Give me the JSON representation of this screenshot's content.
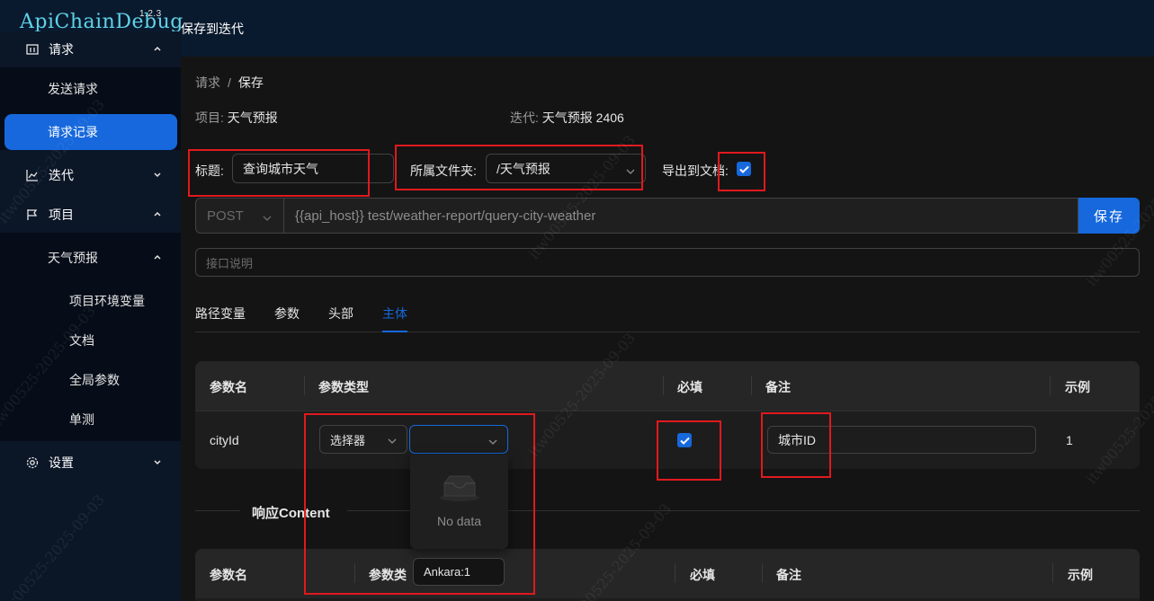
{
  "app": {
    "logo": "ApiChainDebug",
    "version": "1.2.3",
    "header_title": "保存到迭代"
  },
  "sidebar": {
    "request_group": "请求",
    "send_request": "发送请求",
    "request_history": "请求记录",
    "iteration_group": "迭代",
    "project_group": "项目",
    "weather_project": "天气预报",
    "env_vars": "项目环境变量",
    "docs": "文档",
    "global_params": "全局参数",
    "unit_test": "单测",
    "settings_group": "设置"
  },
  "breadcrumb": {
    "parent": "请求",
    "sep": "/",
    "current": "保存"
  },
  "meta": {
    "project_label": "项目:",
    "project_value": "天气预报",
    "iteration_label": "迭代:",
    "iteration_value": "天气预报 2406"
  },
  "form": {
    "title_label": "标题:",
    "title_value": "查询城市天气",
    "folder_label": "所属文件夹:",
    "folder_value": "/天气预报",
    "export_label": "导出到文档:",
    "export_checked": true,
    "method": "POST",
    "url": "{{api_host}} test/weather-report/query-city-weather",
    "save_label": "保存",
    "desc_placeholder": "接口说明"
  },
  "tabs": [
    "路径变量",
    "参数",
    "头部",
    "主体"
  ],
  "active_tab": "主体",
  "body_table": {
    "headers": [
      "参数名",
      "参数类型",
      "必填",
      "备注",
      "示例"
    ],
    "rows": [
      {
        "name": "cityId",
        "type": "选择器",
        "subtype": "",
        "required": true,
        "remark": "城市ID",
        "example": "1"
      }
    ]
  },
  "dropdown": {
    "empty_text": "No data"
  },
  "response": {
    "title": "响应Content",
    "headers": [
      "参数名",
      "参数类",
      "必填",
      "备注",
      "示例"
    ],
    "overlay_input": "Ankara:1"
  },
  "watermark": "itw00525-2025-09-03",
  "colors": {
    "accent": "#1668dc",
    "highlight": "#e0191e",
    "logo": "#5fd3e8"
  }
}
